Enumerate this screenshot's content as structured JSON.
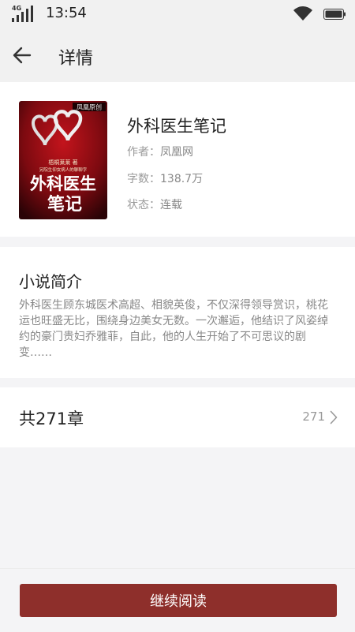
{
  "status_bar": {
    "network": "4G",
    "time": "13:54",
    "icons": [
      "signal-icon",
      "wifi-icon",
      "battery-icon"
    ]
  },
  "app_bar": {
    "back_icon": "arrow-left-icon",
    "title": "详情"
  },
  "book": {
    "title": "外科医生笔记",
    "author_label": "作者：",
    "author": "凤凰网",
    "words_label": "字数：",
    "words": "138.7万",
    "status_label": "状态：",
    "status": "连载",
    "cover": {
      "publisher": "凤凰原创",
      "byline": "梧桐莱莱 著",
      "tagline": "另院生仰女病人的聊聊字",
      "title_line1": "外科医生",
      "title_line2": "笔记",
      "colors": {
        "bg_dark": "#3a0508",
        "bg_red": "#9b0f14",
        "heart": "#d8d8d8"
      }
    }
  },
  "intro": {
    "heading": "小说简介",
    "text": "外科医生顾东城医术高超、相貌英俊，不仅深得领导赏识，桃花运也旺盛无比，围绕身边美女无数。一次邂逅，他结识了风姿绰约的豪门贵妇乔雅菲，自此，他的人生开始了不可思议的剧变……"
  },
  "chapters": {
    "label": "共271章",
    "count": "271",
    "chevron_icon": "chevron-right-icon"
  },
  "footer": {
    "read_button": "继续阅读"
  },
  "colors": {
    "accent": "#8e2f2b",
    "background": "#f4f4f6",
    "card": "#ffffff",
    "muted_text": "#888888"
  }
}
